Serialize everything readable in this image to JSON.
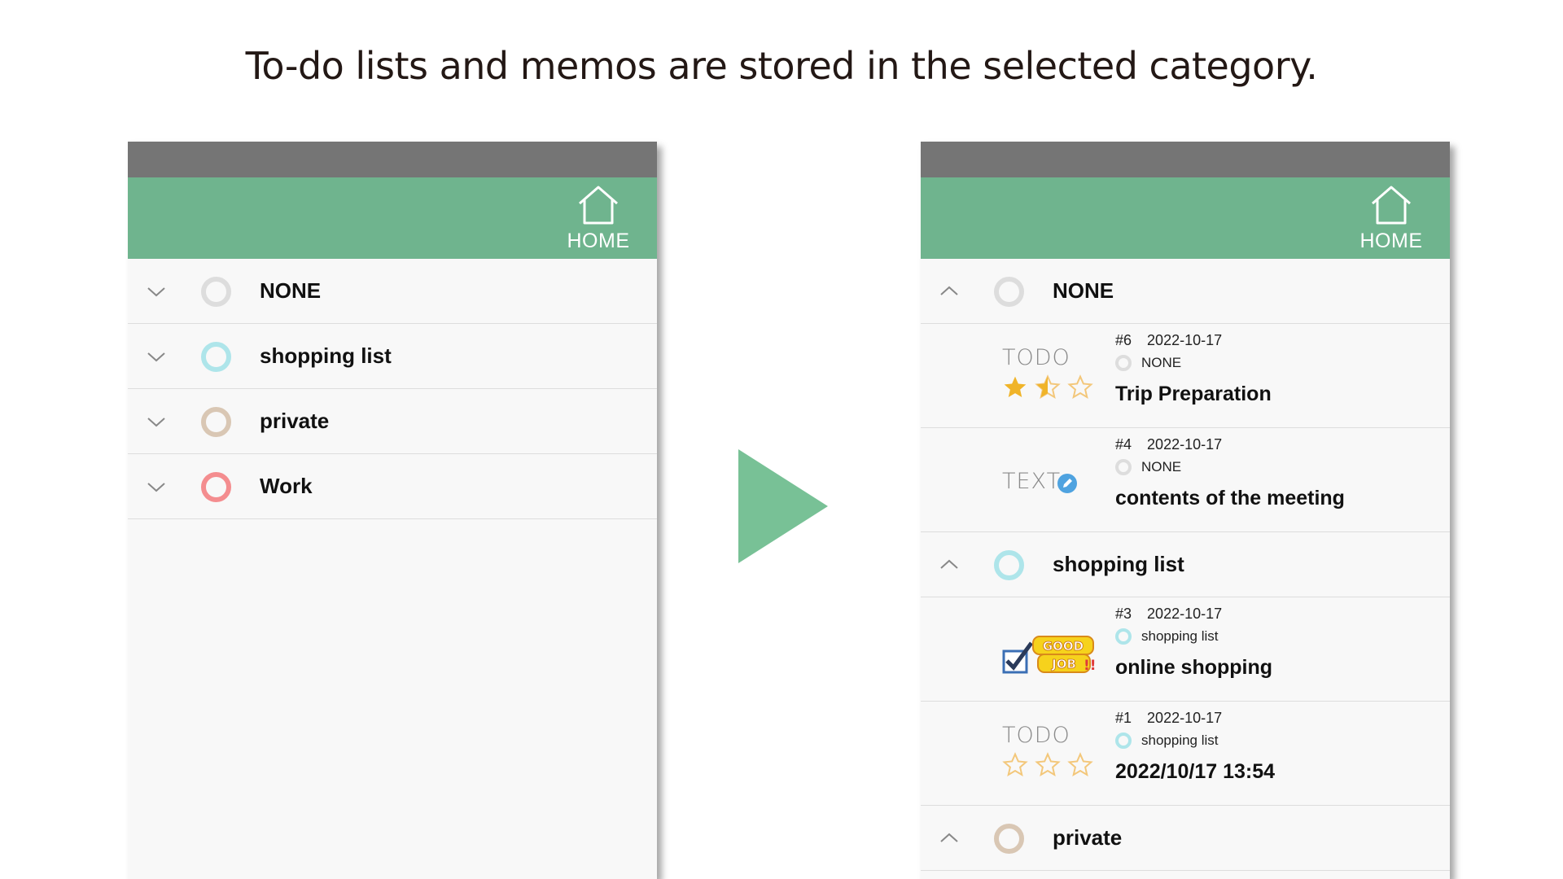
{
  "headline": "To-do lists and memos are stored in the selected category.",
  "colors": {
    "appbar": "#6fb48e",
    "statusbar": "#757575",
    "arrow": "#78c196",
    "none_ring": "#dddddd",
    "shopping_ring": "#aee5ea",
    "private_ring": "#d9c7b4",
    "work_ring": "#f48d8f",
    "star_filled": "#f0b429",
    "star_outline": "#f3c77a"
  },
  "left_screen": {
    "home_label": "HOME",
    "categories": [
      {
        "label": "NONE",
        "color": "#dddddd"
      },
      {
        "label": "shopping list",
        "color": "#aee5ea"
      },
      {
        "label": "private",
        "color": "#d9c7b4"
      },
      {
        "label": "Work",
        "color": "#f48d8f"
      }
    ]
  },
  "right_screen": {
    "home_label": "HOME",
    "groups": [
      {
        "label": "NONE",
        "color": "#dddddd",
        "items": [
          {
            "num": "#6",
            "date": "2022-10-17",
            "category": "NONE",
            "title": "Trip Preparation",
            "kind": "TODO",
            "rating": 1.5
          },
          {
            "num": "#4",
            "date": "2022-10-17",
            "category": "NONE",
            "title": "contents of the meeting",
            "kind": "TEXT"
          }
        ]
      },
      {
        "label": "shopping list",
        "color": "#aee5ea",
        "items": [
          {
            "num": "#3",
            "date": "2022-10-17",
            "category": "shopping list",
            "title": "online shopping",
            "kind": "DONE",
            "badge": "GOOD JOB!!"
          },
          {
            "num": "#1",
            "date": "2022-10-17",
            "category": "shopping list",
            "title": "2022/10/17 13:54",
            "kind": "TODO",
            "rating": 0
          }
        ]
      },
      {
        "label": "private",
        "color": "#d9c7b4",
        "items": []
      }
    ],
    "todo_label": "TODO",
    "text_label": "TEXT"
  }
}
